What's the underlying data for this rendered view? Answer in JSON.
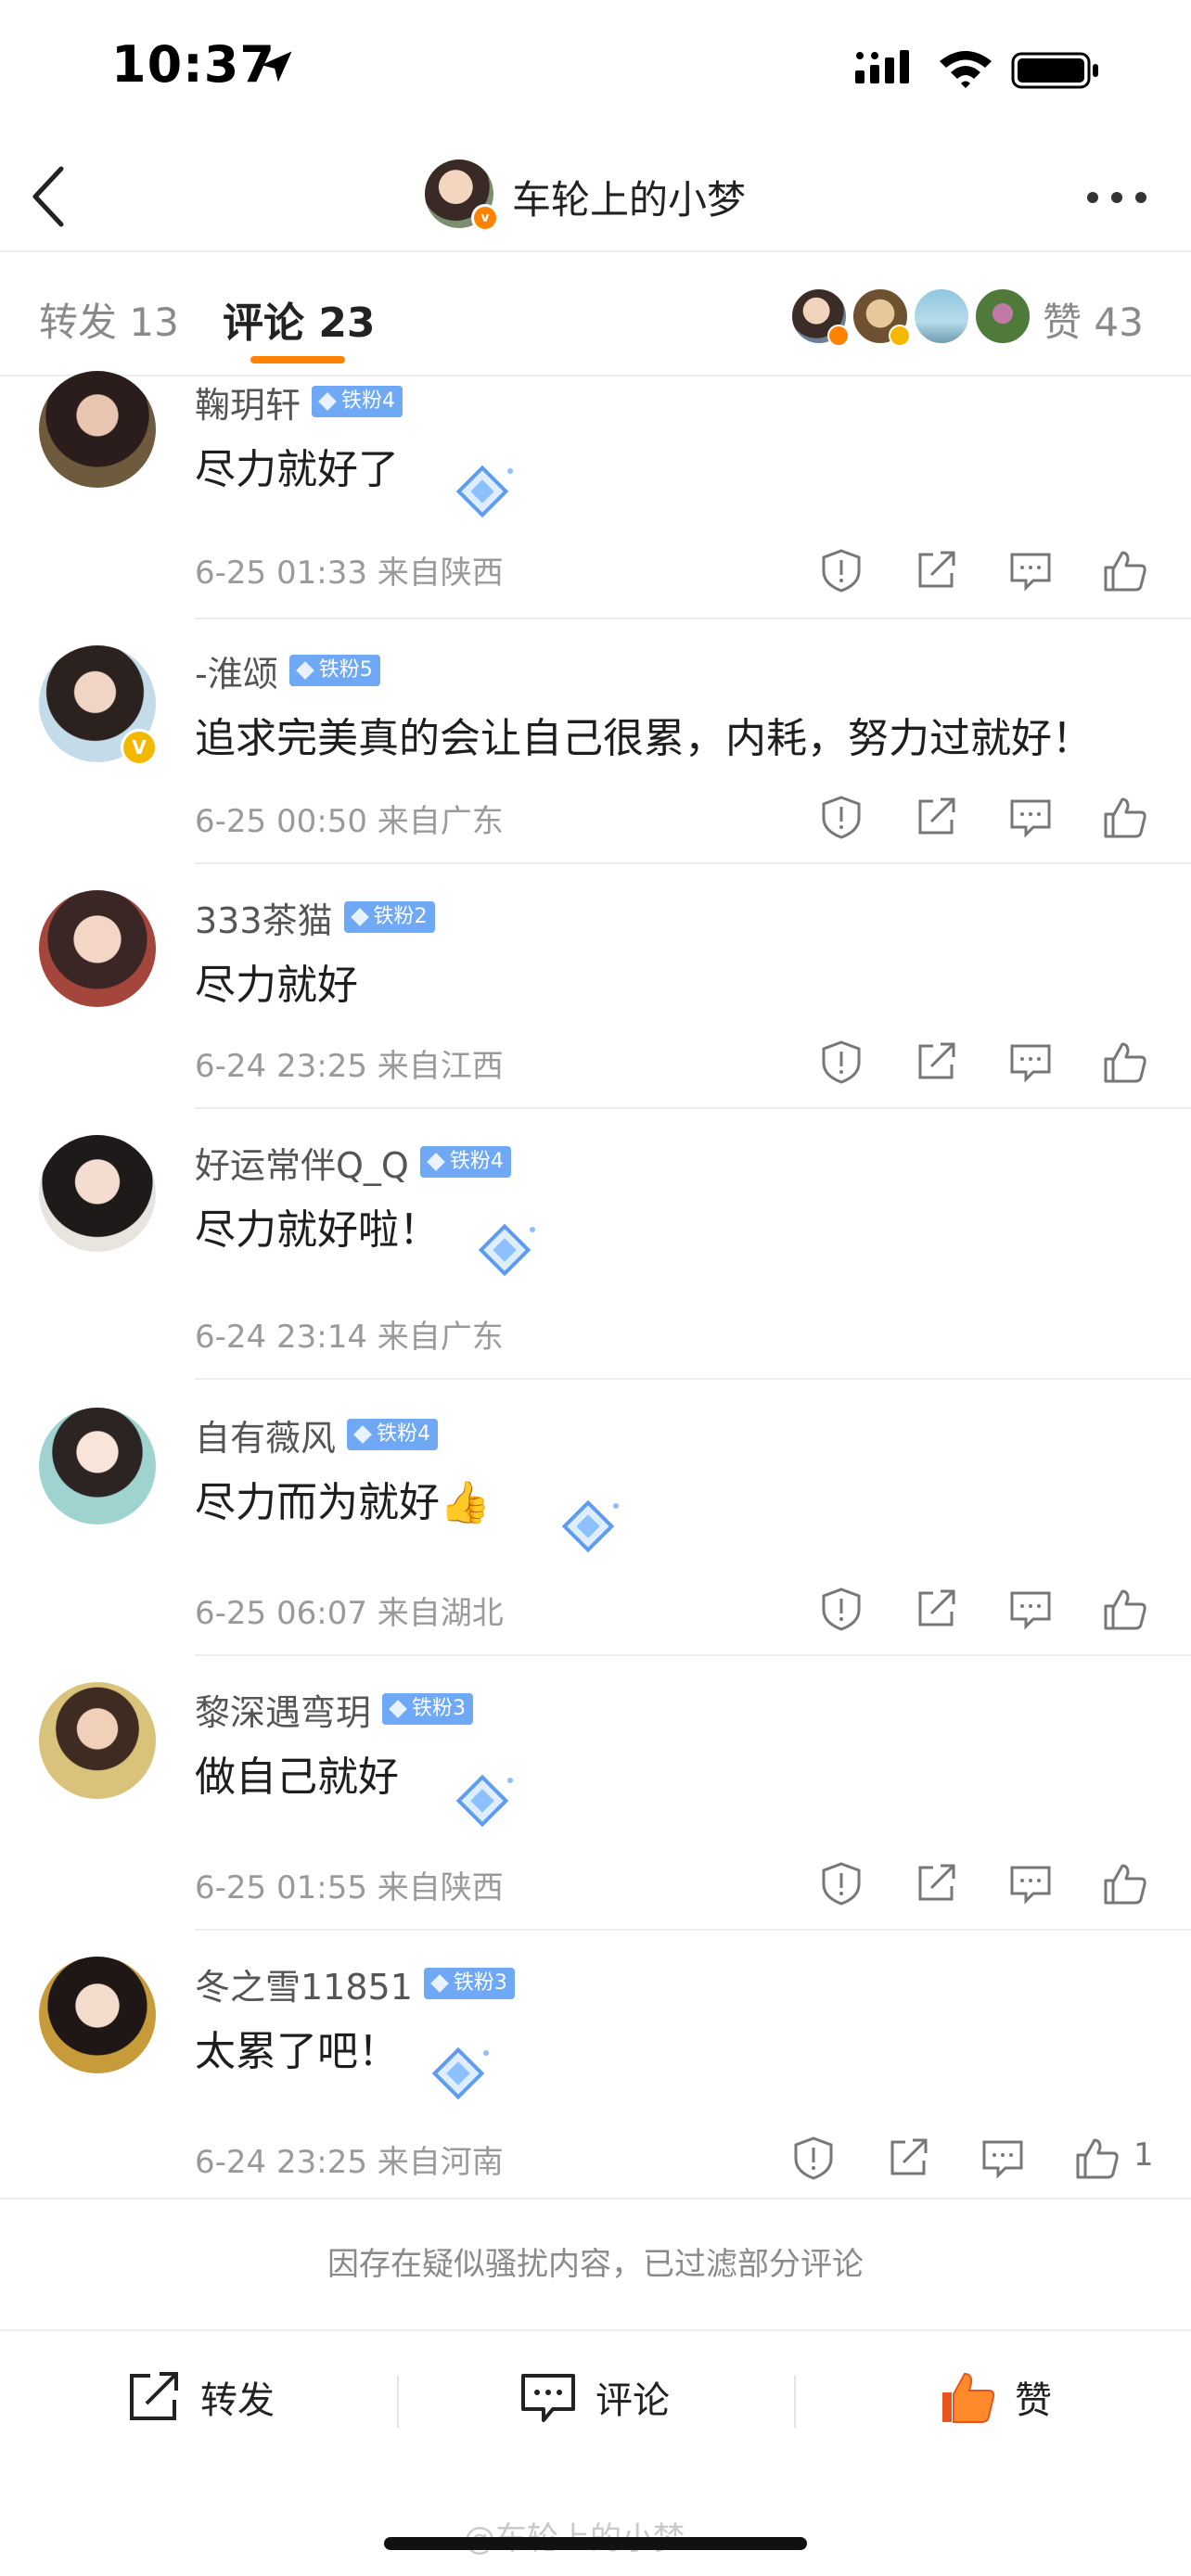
{
  "status_bar": {
    "time": "10:37"
  },
  "nav": {
    "title": "车轮上的小梦"
  },
  "tabs": {
    "repost": "转发 13",
    "comment": "评论 23",
    "like": "赞 43"
  },
  "comments": [
    {
      "name": "鞠玥轩",
      "fan_badge": "铁粉4",
      "text": "尽力就好了",
      "meta": "6-25 01:33 来自陕西",
      "likes": ""
    },
    {
      "name": "-淮颂",
      "fan_badge": "铁粉5",
      "text": "追求完美真的会让自己很累，内耗，努力过就好！",
      "meta": "6-25 00:50 来自广东",
      "likes": ""
    },
    {
      "name": "333茶猫",
      "fan_badge": "铁粉2",
      "text": "尽力就好",
      "meta": "6-24 23:25 来自江西",
      "likes": ""
    },
    {
      "name": "好运常伴Q_Q",
      "fan_badge": "铁粉4",
      "text": "尽力就好啦！",
      "meta": "6-24 23:14 来自广东",
      "likes": ""
    },
    {
      "name": "自有薇风",
      "fan_badge": "铁粉4",
      "text": "尽力而为就好👍",
      "meta": "6-25 06:07 来自湖北",
      "likes": ""
    },
    {
      "name": "黎深遇弯玥",
      "fan_badge": "铁粉3",
      "text": "做自己就好",
      "meta": "6-25 01:55 来自陕西",
      "likes": ""
    },
    {
      "name": "冬之雪11851",
      "fan_badge": "铁粉3",
      "text": "太累了吧！",
      "meta": "6-24 23:25 来自河南",
      "likes": "1"
    }
  ],
  "notice": "因存在疑似骚扰内容，已过滤部分评论",
  "bottom_bar": {
    "repost": "转发",
    "comment": "评论",
    "like": "赞"
  },
  "watermark": "@车轮上的小梦",
  "colors": {
    "accent": "#ff8200",
    "fan_badge": "#6fa8f5",
    "muted": "#9a9a9a"
  }
}
